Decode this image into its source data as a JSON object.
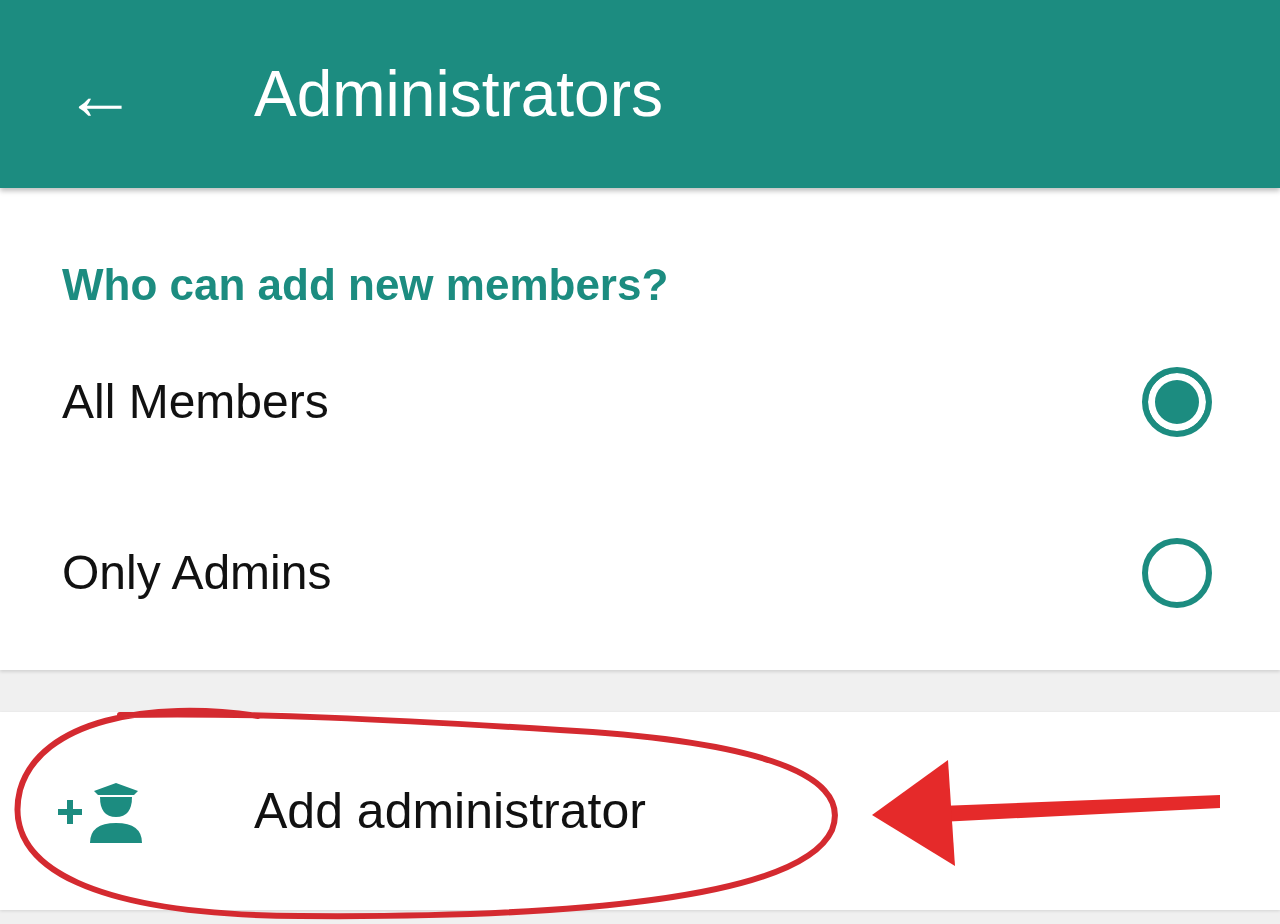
{
  "app_bar": {
    "back_icon": "←",
    "title": "Administrators"
  },
  "section": {
    "heading": "Who can add new members?",
    "options": [
      {
        "label": "All Members",
        "selected": true
      },
      {
        "label": "Only Admins",
        "selected": false
      }
    ]
  },
  "action": {
    "label": "Add administrator"
  }
}
